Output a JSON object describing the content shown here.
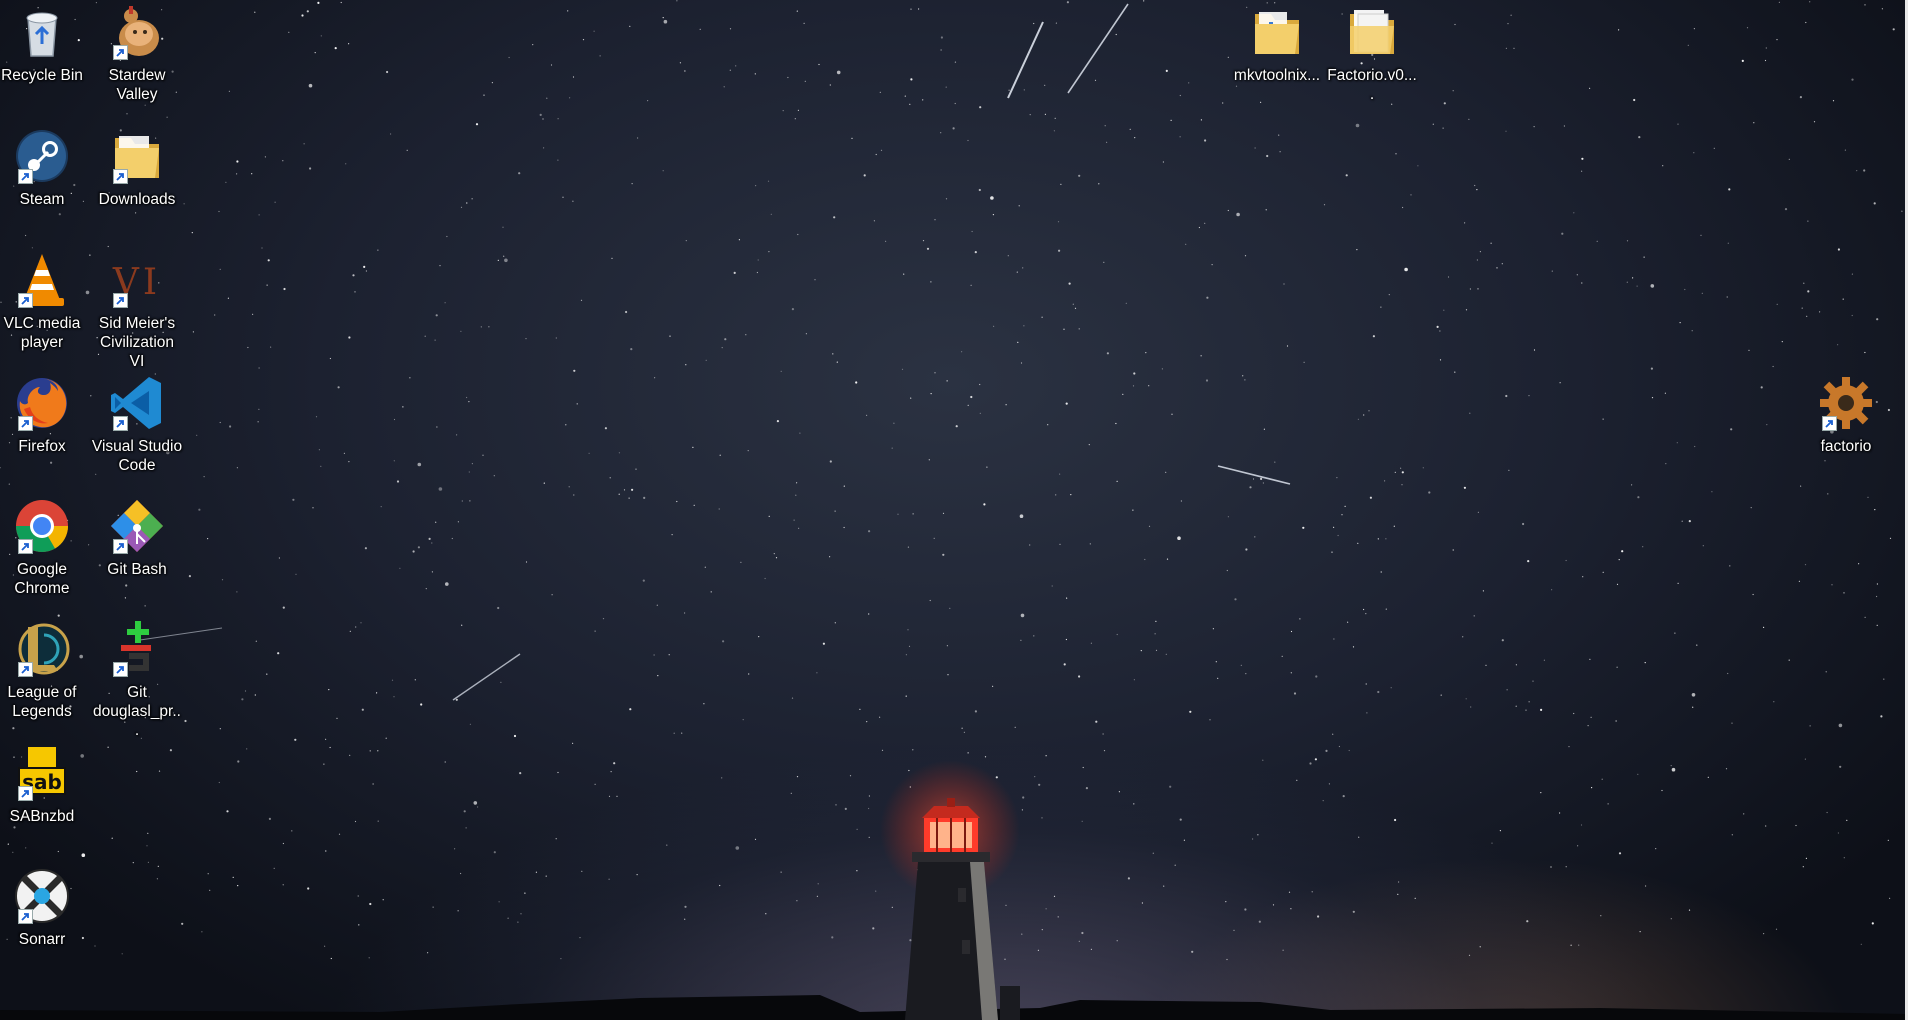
{
  "desktop": {
    "left_column": [
      {
        "label": "Recycle Bin",
        "icon": "recycle-bin-icon",
        "shortcut": false
      },
      {
        "label": "Steam",
        "icon": "steam-icon",
        "shortcut": true
      },
      {
        "label": "VLC media player",
        "icon": "vlc-icon",
        "shortcut": true
      },
      {
        "label": "Firefox",
        "icon": "firefox-icon",
        "shortcut": true
      },
      {
        "label": "Google Chrome",
        "icon": "chrome-icon",
        "shortcut": true
      },
      {
        "label": "League of Legends",
        "icon": "league-of-legends-icon",
        "shortcut": true
      },
      {
        "label": "SABnzbd",
        "icon": "sabnzbd-icon",
        "shortcut": true
      },
      {
        "label": "Sonarr",
        "icon": "sonarr-icon",
        "shortcut": true
      }
    ],
    "second_column": [
      {
        "label": "Stardew Valley",
        "icon": "stardew-valley-icon",
        "shortcut": true
      },
      {
        "label": "Downloads",
        "icon": "folder-icon",
        "shortcut": true
      },
      {
        "label": "Sid Meier's Civilization VI",
        "icon": "civilization-vi-icon",
        "shortcut": true
      },
      {
        "label": "Visual Studio Code",
        "icon": "vscode-icon",
        "shortcut": true
      },
      {
        "label": "Git Bash",
        "icon": "git-bash-icon",
        "shortcut": true
      },
      {
        "label": "Git douglasl_pr...",
        "icon": "git-repo-icon",
        "shortcut": true
      }
    ],
    "top_right": [
      {
        "label": "mkvtoolnix...",
        "icon": "folder-icon",
        "shortcut": false
      },
      {
        "label": "Factorio.v0....",
        "icon": "folder-icon",
        "shortcut": false
      }
    ],
    "right": [
      {
        "label": "factorio",
        "icon": "factorio-gear-icon",
        "shortcut": true
      }
    ]
  },
  "colors": {
    "folder": "#e8c15a",
    "vlc_orange": "#f08a00",
    "vscode_blue": "#1f8ad2",
    "chrome_red": "#db4437",
    "chrome_yellow": "#f4b400",
    "chrome_green": "#0f9d58",
    "chrome_blue": "#4285f4",
    "sab_yellow": "#f6c700",
    "lighthouse_light": "#ff3b2a"
  }
}
